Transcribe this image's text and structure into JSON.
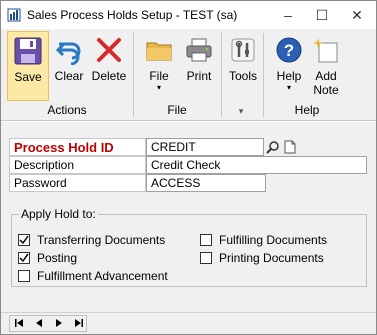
{
  "window": {
    "title": "Sales Process Holds Setup  -  TEST (sa)",
    "minimize": "–",
    "maximize": "☐",
    "close": "✕"
  },
  "ribbon": {
    "save": "Save",
    "clear": "Clear",
    "delete": "Delete",
    "file": "File",
    "print": "Print",
    "tools": "Tools",
    "help": "Help",
    "add_note_line1": "Add",
    "add_note_line2": "Note",
    "groups": {
      "actions": "Actions",
      "file": "File",
      "tools": "▾",
      "help": "Help"
    },
    "caret": "▾"
  },
  "form": {
    "process_hold_id_label": "Process Hold ID",
    "process_hold_id_value": "CREDIT",
    "description_label": "Description",
    "description_value": "Credit Check",
    "password_label": "Password",
    "password_value": "ACCESS"
  },
  "apply_hold": {
    "title": "Apply Hold to:",
    "options": [
      {
        "label": "Transferring Documents",
        "checked": true
      },
      {
        "label": "Posting",
        "checked": true
      },
      {
        "label": "Fulfillment Advancement",
        "checked": false
      },
      {
        "label": "Fulfilling Documents",
        "checked": false
      },
      {
        "label": "Printing Documents",
        "checked": false
      }
    ]
  },
  "colors": {
    "required_label": "#c00000",
    "save_highlight": "#fce9a6",
    "ribbon_bg": "#f0f0f0"
  }
}
